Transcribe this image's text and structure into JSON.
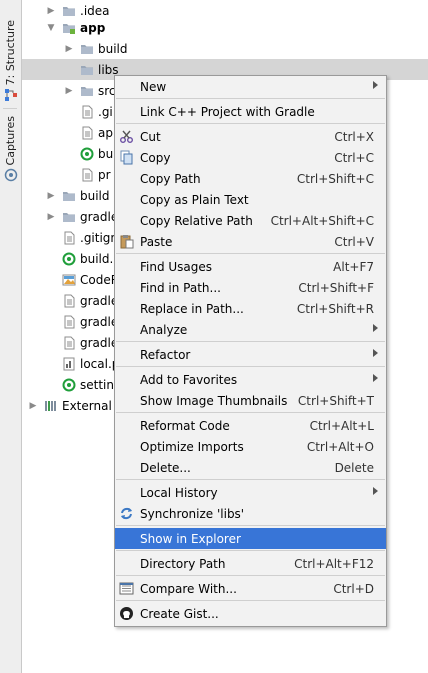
{
  "left_strip": {
    "structure_label": "7: Structure",
    "captures_label": "Captures"
  },
  "tree": [
    {
      "label": "idea",
      "prefix": ".",
      "indent": 1,
      "arrow": "right",
      "icon": "folder-icon",
      "bold": false
    },
    {
      "label": "app",
      "prefix": "",
      "indent": 1,
      "arrow": "down",
      "icon": "module-folder-icon",
      "bold": true
    },
    {
      "label": "build",
      "prefix": "",
      "indent": 2,
      "arrow": "right",
      "icon": "folder-icon",
      "bold": false
    },
    {
      "label": "libs",
      "prefix": "",
      "indent": 2,
      "arrow": "none",
      "icon": "folder-icon",
      "bold": false,
      "selected": true
    },
    {
      "label": "src",
      "prefix": "",
      "indent": 2,
      "arrow": "right",
      "icon": "folder-icon",
      "bold": false
    },
    {
      "label": ".gi",
      "prefix": "",
      "indent": 2,
      "arrow": "none",
      "icon": "file-icon",
      "bold": false
    },
    {
      "label": "ap",
      "prefix": "",
      "indent": 2,
      "arrow": "none",
      "icon": "file-icon",
      "bold": false
    },
    {
      "label": "bu",
      "prefix": "",
      "indent": 2,
      "arrow": "none",
      "icon": "gradle-icon",
      "bold": false
    },
    {
      "label": "pr",
      "prefix": "",
      "indent": 2,
      "arrow": "none",
      "icon": "file-icon",
      "bold": false
    },
    {
      "label": "build",
      "prefix": "",
      "indent": 1,
      "arrow": "right",
      "icon": "folder-icon",
      "bold": false
    },
    {
      "label": "gradle",
      "prefix": "",
      "indent": 1,
      "arrow": "right",
      "icon": "folder-icon",
      "bold": false
    },
    {
      "label": ".gitign",
      "prefix": "",
      "indent": 1,
      "arrow": "none",
      "icon": "file-icon",
      "bold": false
    },
    {
      "label": "build.g",
      "prefix": "",
      "indent": 1,
      "arrow": "none",
      "icon": "gradle-icon",
      "bold": false
    },
    {
      "label": "CodeR",
      "prefix": "",
      "indent": 1,
      "arrow": "none",
      "icon": "image-file-icon",
      "bold": false
    },
    {
      "label": "gradle",
      "prefix": "",
      "indent": 1,
      "arrow": "none",
      "icon": "file-icon",
      "bold": false
    },
    {
      "label": "gradle",
      "prefix": "",
      "indent": 1,
      "arrow": "none",
      "icon": "file-icon",
      "bold": false
    },
    {
      "label": "gradle",
      "prefix": "",
      "indent": 1,
      "arrow": "none",
      "icon": "file-icon",
      "bold": false
    },
    {
      "label": "local.p",
      "prefix": "",
      "indent": 1,
      "arrow": "none",
      "icon": "properties-file-icon",
      "bold": false
    },
    {
      "label": "setting",
      "prefix": "",
      "indent": 1,
      "arrow": "none",
      "icon": "gradle-icon",
      "bold": false
    },
    {
      "label": "External L",
      "prefix": "",
      "indent": 0,
      "arrow": "right",
      "icon": "library-icon",
      "bold": false
    }
  ],
  "menu": [
    {
      "label": "New",
      "shortcut": "",
      "submenu": true,
      "icon": ""
    },
    {
      "sep": true
    },
    {
      "label": "Link C++ Project with Gradle",
      "shortcut": "",
      "submenu": false,
      "icon": ""
    },
    {
      "sep": true
    },
    {
      "label": "Cut",
      "shortcut": "Ctrl+X",
      "submenu": false,
      "icon": "scissors-icon"
    },
    {
      "label": "Copy",
      "shortcut": "Ctrl+C",
      "submenu": false,
      "icon": "copy-icon"
    },
    {
      "label": "Copy Path",
      "shortcut": "Ctrl+Shift+C",
      "submenu": false,
      "icon": ""
    },
    {
      "label": "Copy as Plain Text",
      "shortcut": "",
      "submenu": false,
      "icon": ""
    },
    {
      "label": "Copy Relative Path",
      "shortcut": "Ctrl+Alt+Shift+C",
      "submenu": false,
      "icon": ""
    },
    {
      "label": "Paste",
      "shortcut": "Ctrl+V",
      "submenu": false,
      "icon": "paste-icon"
    },
    {
      "sep": true
    },
    {
      "label": "Find Usages",
      "shortcut": "Alt+F7",
      "submenu": false,
      "icon": ""
    },
    {
      "label": "Find in Path...",
      "shortcut": "Ctrl+Shift+F",
      "submenu": false,
      "icon": ""
    },
    {
      "label": "Replace in Path...",
      "shortcut": "Ctrl+Shift+R",
      "submenu": false,
      "icon": ""
    },
    {
      "label": "Analyze",
      "shortcut": "",
      "submenu": true,
      "icon": ""
    },
    {
      "sep": true
    },
    {
      "label": "Refactor",
      "shortcut": "",
      "submenu": true,
      "icon": ""
    },
    {
      "sep": true
    },
    {
      "label": "Add to Favorites",
      "shortcut": "",
      "submenu": true,
      "icon": ""
    },
    {
      "label": "Show Image Thumbnails",
      "shortcut": "Ctrl+Shift+T",
      "submenu": false,
      "icon": ""
    },
    {
      "sep": true
    },
    {
      "label": "Reformat Code",
      "shortcut": "Ctrl+Alt+L",
      "submenu": false,
      "icon": ""
    },
    {
      "label": "Optimize Imports",
      "shortcut": "Ctrl+Alt+O",
      "submenu": false,
      "icon": ""
    },
    {
      "label": "Delete...",
      "shortcut": "Delete",
      "submenu": false,
      "icon": ""
    },
    {
      "sep": true
    },
    {
      "label": "Local History",
      "shortcut": "",
      "submenu": true,
      "icon": ""
    },
    {
      "label": "Synchronize 'libs'",
      "shortcut": "",
      "submenu": false,
      "icon": "sync-icon"
    },
    {
      "sep": true
    },
    {
      "label": "Show in Explorer",
      "shortcut": "",
      "submenu": false,
      "icon": "",
      "highlighted": true
    },
    {
      "sep": true
    },
    {
      "label": "Directory Path",
      "shortcut": "Ctrl+Alt+F12",
      "submenu": false,
      "icon": ""
    },
    {
      "sep": true
    },
    {
      "label": "Compare With...",
      "shortcut": "Ctrl+D",
      "submenu": false,
      "icon": "compare-icon"
    },
    {
      "sep": true
    },
    {
      "label": "Create Gist...",
      "shortcut": "",
      "submenu": false,
      "icon": "github-icon"
    }
  ]
}
